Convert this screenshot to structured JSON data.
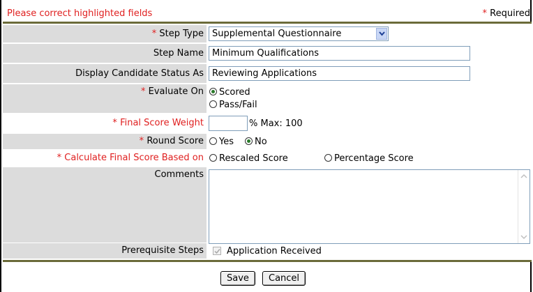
{
  "header": {
    "error_message": "Please correct highlighted fields",
    "required_star": "*",
    "required_label": "Required"
  },
  "form": {
    "step_type": {
      "star": "*",
      "label": "Step Type",
      "value": "Supplemental Questionnaire"
    },
    "step_name": {
      "label": "Step Name",
      "value": "Minimum Qualifications"
    },
    "display_status": {
      "label": "Display Candidate Status As",
      "value": "Reviewing Applications"
    },
    "evaluate_on": {
      "star": "*",
      "label": "Evaluate On",
      "options": [
        "Scored",
        "Pass/Fail"
      ],
      "selected": "Scored"
    },
    "final_score_weight": {
      "star": "*",
      "label": "Final Score Weight",
      "value": "",
      "suffix": "% Max: 100"
    },
    "round_score": {
      "star": "*",
      "label": "Round Score",
      "options": [
        "Yes",
        "No"
      ],
      "selected": "No"
    },
    "calc_final_score": {
      "star": "*",
      "label": "Calculate Final Score Based on",
      "options": [
        "Rescaled Score",
        "Percentage Score"
      ],
      "selected": ""
    },
    "comments": {
      "label": "Comments",
      "value": ""
    },
    "prerequisite_steps": {
      "label": "Prerequisite Steps",
      "items": [
        {
          "label": "Application Received",
          "checked": true,
          "disabled": true
        }
      ]
    }
  },
  "buttons": {
    "save": "Save",
    "cancel": "Cancel"
  },
  "colors": {
    "error": "#e02020",
    "label_bg": "#dcdcdc",
    "border_accent": "#6b6b3a",
    "radio_dot": "#2a7a2a"
  }
}
